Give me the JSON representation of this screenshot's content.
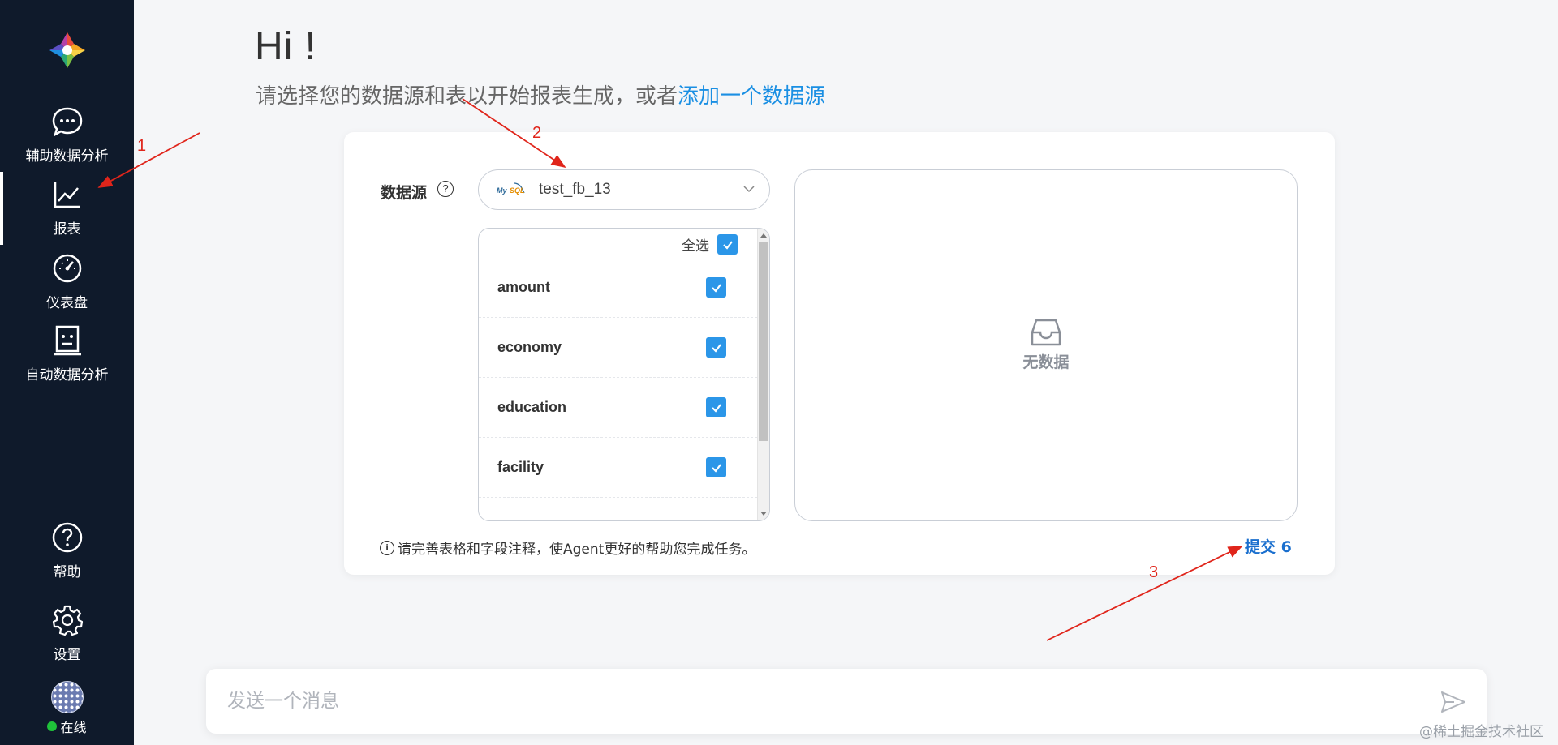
{
  "sidebar": {
    "items": [
      {
        "label": "辅助数据分析",
        "icon": "chat-bubble-icon"
      },
      {
        "label": "报表",
        "icon": "line-chart-icon",
        "active": true
      },
      {
        "label": "仪表盘",
        "icon": "gauge-icon"
      },
      {
        "label": "自动数据分析",
        "icon": "robot-icon"
      }
    ],
    "bottom_items": [
      {
        "label": "帮助",
        "icon": "help-icon"
      },
      {
        "label": "设置",
        "icon": "gear-icon"
      }
    ],
    "status": {
      "label": "在线",
      "color": "#1fc23a"
    }
  },
  "main": {
    "greeting": "Hi !",
    "subtitle_prefix": "请选择您的数据源和表以开始报表生成，或者",
    "subtitle_link": "添加一个数据源"
  },
  "form": {
    "datasource_label": "数据源",
    "datasource_help": "?",
    "selected_datasource": "test_fb_13",
    "datasource_logo_text_1": "My",
    "datasource_logo_text_2": "SQL",
    "select_all_label": "全选",
    "select_all_checked": true,
    "tables": [
      {
        "name": "amount",
        "checked": true
      },
      {
        "name": "economy",
        "checked": true
      },
      {
        "name": "education",
        "checked": true
      },
      {
        "name": "facility",
        "checked": true
      }
    ],
    "empty_text": "无数据",
    "note": "请完善表格和字段注释，使Agent更好的帮助您完成任务。",
    "submit_label": "提交 6"
  },
  "annotations": {
    "a1": "1",
    "a2": "2",
    "a3": "3"
  },
  "message": {
    "placeholder": "发送一个消息"
  },
  "watermark": "@稀土掘金技术社区",
  "colors": {
    "sidebar": "#0f1a2b",
    "accent": "#2b96e8",
    "link": "#1a8fe3",
    "annotation": "#e0251b"
  }
}
